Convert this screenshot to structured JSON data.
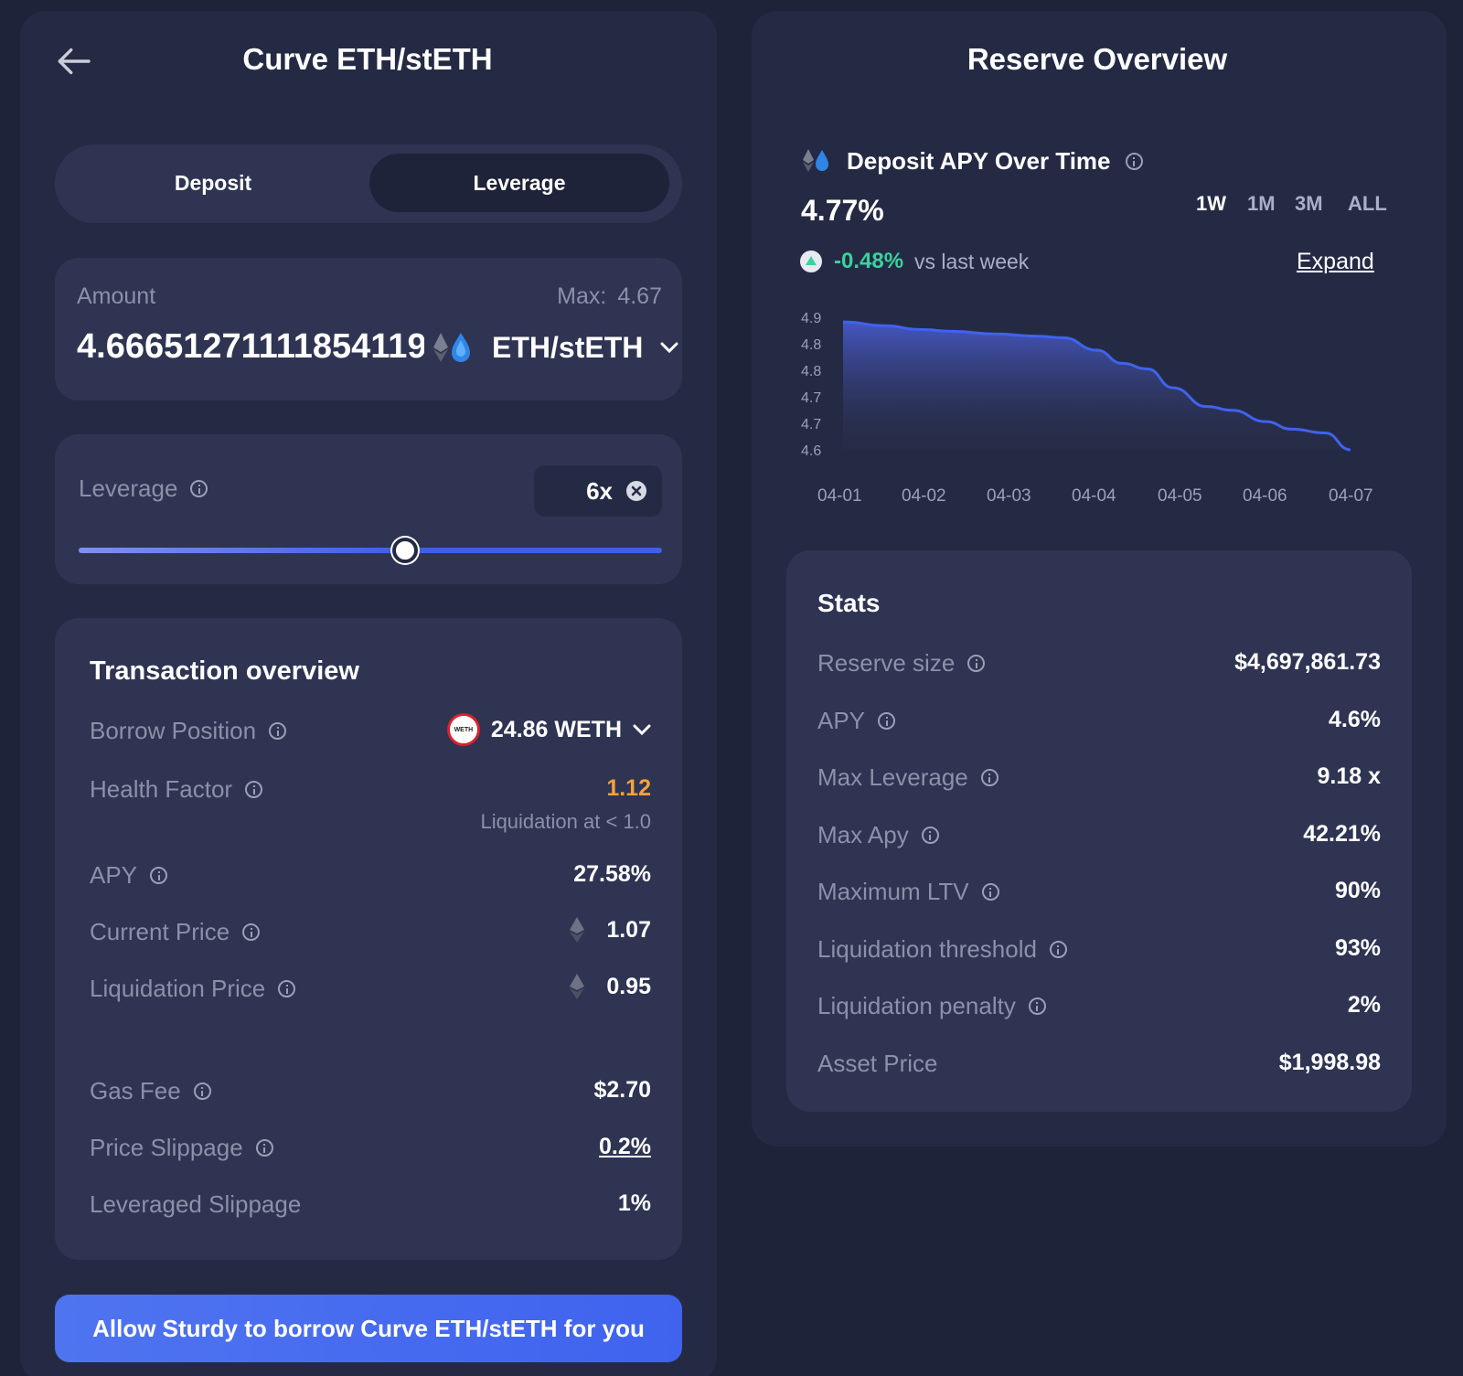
{
  "left": {
    "title": "Curve ETH/stETH",
    "tabs": [
      {
        "label": "Deposit",
        "active": false
      },
      {
        "label": "Leverage",
        "active": true
      }
    ],
    "amount": {
      "label": "Amount",
      "max_label": "Max:",
      "max_value": "4.67",
      "value": "4.666512711118541198",
      "token": "ETH/stETH"
    },
    "leverage": {
      "label": "Leverage",
      "value": "6x",
      "slider_fraction": 0.56
    },
    "overview": {
      "title": "Transaction overview",
      "borrow_label": "Borrow Position",
      "borrow_value": "24.86 WETH",
      "borrow_token_badge": "WETH",
      "health_label": "Health Factor",
      "health_value": "1.12",
      "liquidation_note": "Liquidation at < 1.0",
      "apy_label": "APY",
      "apy_value": "27.58%",
      "current_price_label": "Current Price",
      "current_price_value": "1.07",
      "liquidation_price_label": "Liquidation Price",
      "liquidation_price_value": "0.95",
      "gas_label": "Gas Fee",
      "gas_value": "$2.70",
      "slippage_label": "Price Slippage",
      "slippage_value": "0.2%",
      "lev_slippage_label": "Leveraged Slippage",
      "lev_slippage_value": "1%"
    },
    "cta": "Allow Sturdy to borrow Curve ETH/stETH for you"
  },
  "right": {
    "title": "Reserve Overview",
    "chart_header": {
      "title": "Deposit APY Over Time",
      "current": "4.77%",
      "change": "-0.48%",
      "change_suffix": "vs last week",
      "expand": "Expand",
      "periods": [
        "1W",
        "1M",
        "3M",
        "ALL"
      ],
      "active_period": "1W"
    },
    "stats": {
      "title": "Stats",
      "rows": [
        {
          "label": "Reserve size",
          "value": "$4,697,861.73",
          "info": true
        },
        {
          "label": "APY",
          "value": "4.6%",
          "info": true
        },
        {
          "label": "Max Leverage",
          "value": "9.18 x",
          "info": true
        },
        {
          "label": "Max Apy",
          "value": "42.21%",
          "info": true
        },
        {
          "label": "Maximum LTV",
          "value": "90%",
          "info": true
        },
        {
          "label": "Liquidation threshold",
          "value": "93%",
          "info": true
        },
        {
          "label": "Liquidation penalty",
          "value": "2%",
          "info": true
        },
        {
          "label": "Asset Price",
          "value": "$1,998.98",
          "info": false
        }
      ]
    }
  },
  "colors": {
    "background": "#1f2339",
    "panel": "#252a44",
    "card": "#2e3452",
    "accent": "#4a6cf7",
    "health_orange": "#f5a13a",
    "positive_green": "#3ad29f"
  },
  "chart_data": {
    "type": "area",
    "x": [
      "04-01",
      "04-02",
      "04-03",
      "04-04",
      "04-05",
      "04-06",
      "04-07"
    ],
    "y_ticks": [
      "4.9",
      "4.8",
      "4.8",
      "4.7",
      "4.7",
      "4.6"
    ],
    "ylim": [
      4.58,
      4.93
    ],
    "series": [
      {
        "x": [
          0,
          0.5,
          0.9,
          1.3,
          1.8,
          2.3,
          2.6,
          3.0,
          3.3,
          3.6,
          3.9,
          4.3,
          4.6,
          5.0,
          5.3,
          5.7,
          6.0
        ],
        "values": [
          4.92,
          4.91,
          4.9,
          4.895,
          4.888,
          4.882,
          4.878,
          4.845,
          4.81,
          4.795,
          4.745,
          4.695,
          4.685,
          4.655,
          4.635,
          4.625,
          4.58
        ]
      }
    ],
    "grid": false
  }
}
